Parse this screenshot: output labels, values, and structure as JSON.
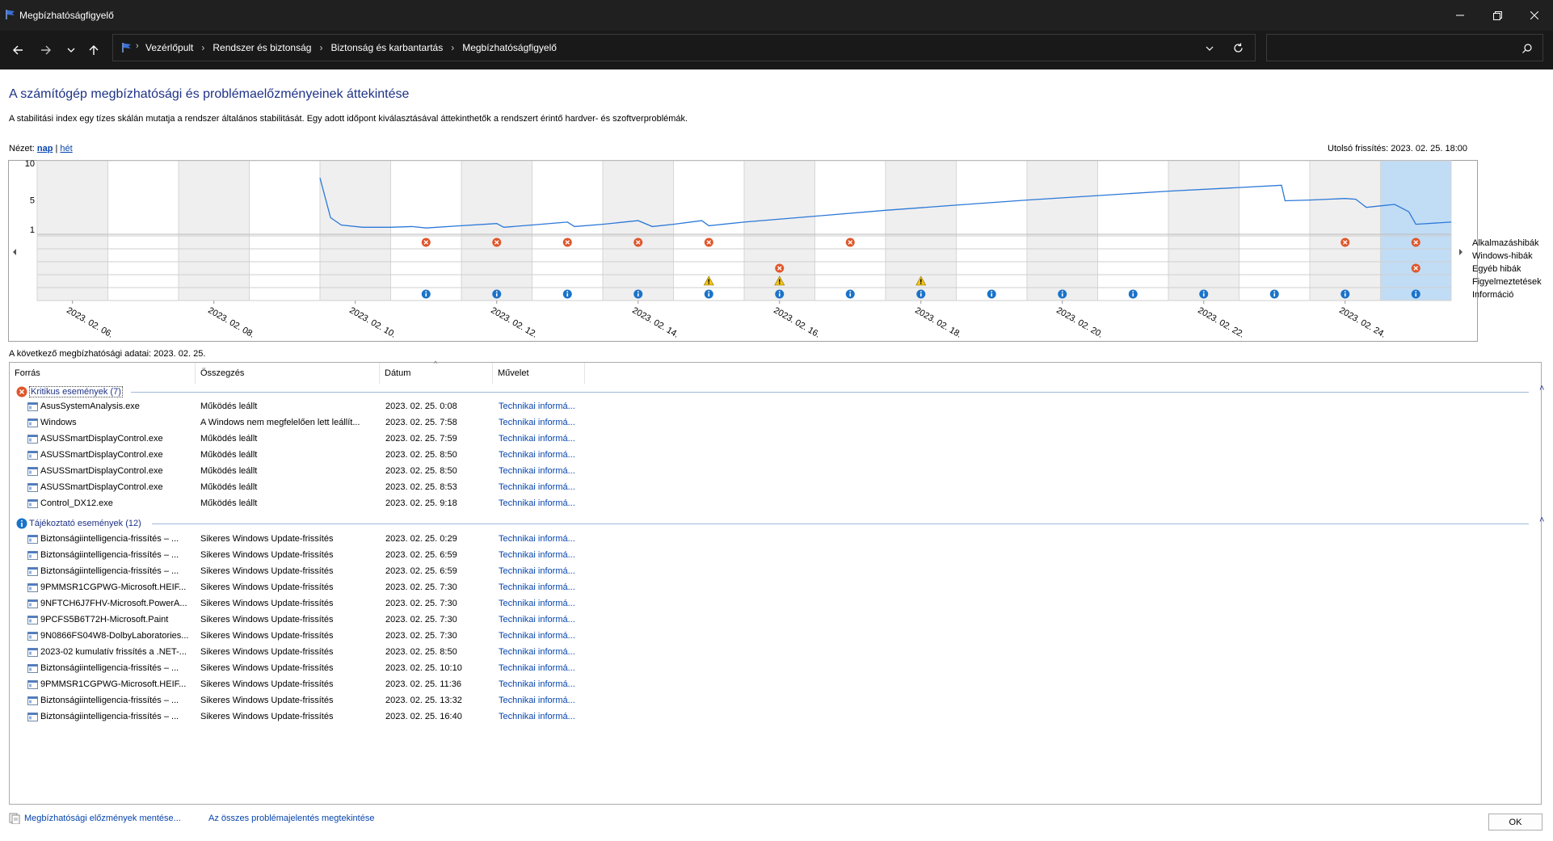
{
  "window": {
    "title": "Megbízhatóságfigyelő"
  },
  "address": {
    "crumbs": [
      "Vezérlőpult",
      "Rendszer és biztonság",
      "Biztonság és karbantartás",
      "Megbízhatóságfigyelő"
    ]
  },
  "page": {
    "heading": "A számítógép megbízhatósági és problémaelőzményeinek áttekintése",
    "description": "A stabilitási index egy tízes skálán mutatja a rendszer általános stabilitását. Egy adott időpont kiválasztásával áttekinthetők a rendszert érintő hardver- és szoftverproblémák.",
    "view_label": "Nézet:",
    "view_day": "nap",
    "view_sep": "|",
    "view_week": "hét",
    "last_update": "Utolsó frissítés: 2023. 02. 25. 18:00",
    "data_for": "A következő megbízhatósági adatai: 2023. 02. 25."
  },
  "chart_data": {
    "type": "line",
    "ylabel_ticks": [
      "10",
      "5",
      "1"
    ],
    "ylim": [
      1,
      10
    ],
    "x_ticks": [
      "2023. 02. 06.",
      "2023. 02. 08.",
      "2023. 02. 10.",
      "2023. 02. 12.",
      "2023. 02. 14.",
      "2023. 02. 16.",
      "2023. 02. 18.",
      "2023. 02. 20.",
      "2023. 02. 22.",
      "2023. 02. 24."
    ],
    "days": [
      "02.05",
      "02.06",
      "02.07",
      "02.08",
      "02.09",
      "02.10",
      "02.11",
      "02.12",
      "02.13",
      "02.14",
      "02.15",
      "02.16",
      "02.17",
      "02.18",
      "02.19",
      "02.20",
      "02.21",
      "02.22",
      "02.23",
      "02.24"
    ],
    "selected_day_index": 19,
    "stability_index": {
      "x": [
        4.0,
        4.15,
        4.3,
        4.6,
        5.0,
        5.3,
        5.5,
        6.0,
        6.5,
        6.6,
        7.0,
        7.5,
        7.6,
        8.0,
        8.5,
        8.7,
        9.0,
        9.4,
        9.5,
        10.0,
        11.0,
        12.0,
        13.0,
        14.0,
        15.0,
        16.0,
        17.0,
        17.6,
        17.65,
        18.0,
        18.5,
        18.65,
        18.8,
        19.0,
        19.2,
        19.4,
        19.5,
        20.0
      ],
      "y": [
        8.0,
        2.6,
        1.6,
        1.3,
        1.3,
        1.4,
        1.2,
        1.5,
        1.8,
        1.3,
        1.6,
        2.0,
        1.4,
        1.7,
        2.2,
        1.4,
        1.7,
        2.2,
        1.5,
        2.0,
        2.8,
        3.6,
        4.3,
        5.0,
        5.6,
        6.2,
        6.7,
        7.0,
        4.9,
        5.0,
        5.2,
        5.1,
        4.0,
        4.2,
        4.4,
        3.4,
        1.7,
        2.0
      ]
    },
    "row_labels": [
      "Alkalmazáshibák",
      "Windows-hibák",
      "Egyéb hibák",
      "Figyelmeztetések",
      "Információ"
    ],
    "markers": {
      "app_errors": [
        5,
        6,
        7,
        8,
        9,
        11,
        18,
        19
      ],
      "windows_errors": [],
      "other_errors": [
        10,
        19
      ],
      "warnings": [
        9,
        10,
        12
      ],
      "info": [
        5,
        6,
        7,
        8,
        9,
        10,
        11,
        12,
        13,
        14,
        15,
        16,
        17,
        18,
        19
      ]
    },
    "colors": {
      "line": "#2b78d8",
      "selected": "#c1dcf5",
      "shaded": "#efefef",
      "error": "#e0562a",
      "warning": "#f2c418",
      "info": "#1b73c9"
    }
  },
  "list": {
    "columns": [
      "Forrás",
      "Összegzés",
      "Dátum",
      "Művelet"
    ],
    "critical": {
      "label": "Kritikus események (7)",
      "rows": [
        {
          "source": "AsusSystemAnalysis.exe",
          "summary": "Működés leállt",
          "date": "2023. 02. 25. 0:08",
          "action": "Technikai informá..."
        },
        {
          "source": "Windows",
          "summary": "A Windows nem megfelelően lett leállít...",
          "date": "2023. 02. 25. 7:58",
          "action": "Technikai informá..."
        },
        {
          "source": "ASUSSmartDisplayControl.exe",
          "summary": "Működés leállt",
          "date": "2023. 02. 25. 7:59",
          "action": "Technikai informá..."
        },
        {
          "source": "ASUSSmartDisplayControl.exe",
          "summary": "Működés leállt",
          "date": "2023. 02. 25. 8:50",
          "action": "Technikai informá..."
        },
        {
          "source": "ASUSSmartDisplayControl.exe",
          "summary": "Működés leállt",
          "date": "2023. 02. 25. 8:50",
          "action": "Technikai informá..."
        },
        {
          "source": "ASUSSmartDisplayControl.exe",
          "summary": "Működés leállt",
          "date": "2023. 02. 25. 8:53",
          "action": "Technikai informá..."
        },
        {
          "source": "Control_DX12.exe",
          "summary": "Működés leállt",
          "date": "2023. 02. 25. 9:18",
          "action": "Technikai informá..."
        }
      ]
    },
    "info": {
      "label": "Tájékoztató események (12)",
      "rows": [
        {
          "source": "Biztonságiintelligencia-frissítés – ...",
          "summary": "Sikeres Windows Update-frissítés",
          "date": "2023. 02. 25. 0:29",
          "action": "Technikai informá..."
        },
        {
          "source": "Biztonságiintelligencia-frissítés – ...",
          "summary": "Sikeres Windows Update-frissítés",
          "date": "2023. 02. 25. 6:59",
          "action": "Technikai informá..."
        },
        {
          "source": "Biztonságiintelligencia-frissítés – ...",
          "summary": "Sikeres Windows Update-frissítés",
          "date": "2023. 02. 25. 6:59",
          "action": "Technikai informá..."
        },
        {
          "source": "9PMMSR1CGPWG-Microsoft.HEIF...",
          "summary": "Sikeres Windows Update-frissítés",
          "date": "2023. 02. 25. 7:30",
          "action": "Technikai informá..."
        },
        {
          "source": "9NFTCH6J7FHV-Microsoft.PowerA...",
          "summary": "Sikeres Windows Update-frissítés",
          "date": "2023. 02. 25. 7:30",
          "action": "Technikai informá..."
        },
        {
          "source": "9PCFS5B6T72H-Microsoft.Paint",
          "summary": "Sikeres Windows Update-frissítés",
          "date": "2023. 02. 25. 7:30",
          "action": "Technikai informá..."
        },
        {
          "source": "9N0866FS04W8-DolbyLaboratories...",
          "summary": "Sikeres Windows Update-frissítés",
          "date": "2023. 02. 25. 7:30",
          "action": "Technikai informá..."
        },
        {
          "source": "2023-02 kumulatív frissítés a .NET-...",
          "summary": "Sikeres Windows Update-frissítés",
          "date": "2023. 02. 25. 8:50",
          "action": "Technikai informá..."
        },
        {
          "source": "Biztonságiintelligencia-frissítés – ...",
          "summary": "Sikeres Windows Update-frissítés",
          "date": "2023. 02. 25. 10:10",
          "action": "Technikai informá..."
        },
        {
          "source": "9PMMSR1CGPWG-Microsoft.HEIF...",
          "summary": "Sikeres Windows Update-frissítés",
          "date": "2023. 02. 25. 11:36",
          "action": "Technikai informá..."
        },
        {
          "source": "Biztonságiintelligencia-frissítés – ...",
          "summary": "Sikeres Windows Update-frissítés",
          "date": "2023. 02. 25. 13:32",
          "action": "Technikai informá..."
        },
        {
          "source": "Biztonságiintelligencia-frissítés – ...",
          "summary": "Sikeres Windows Update-frissítés",
          "date": "2023. 02. 25. 16:40",
          "action": "Technikai informá..."
        }
      ]
    }
  },
  "footer": {
    "save_link": "Megbízhatósági előzmények mentése...",
    "all_reports_link": "Az összes problémajelentés megtekintése",
    "ok": "OK"
  }
}
